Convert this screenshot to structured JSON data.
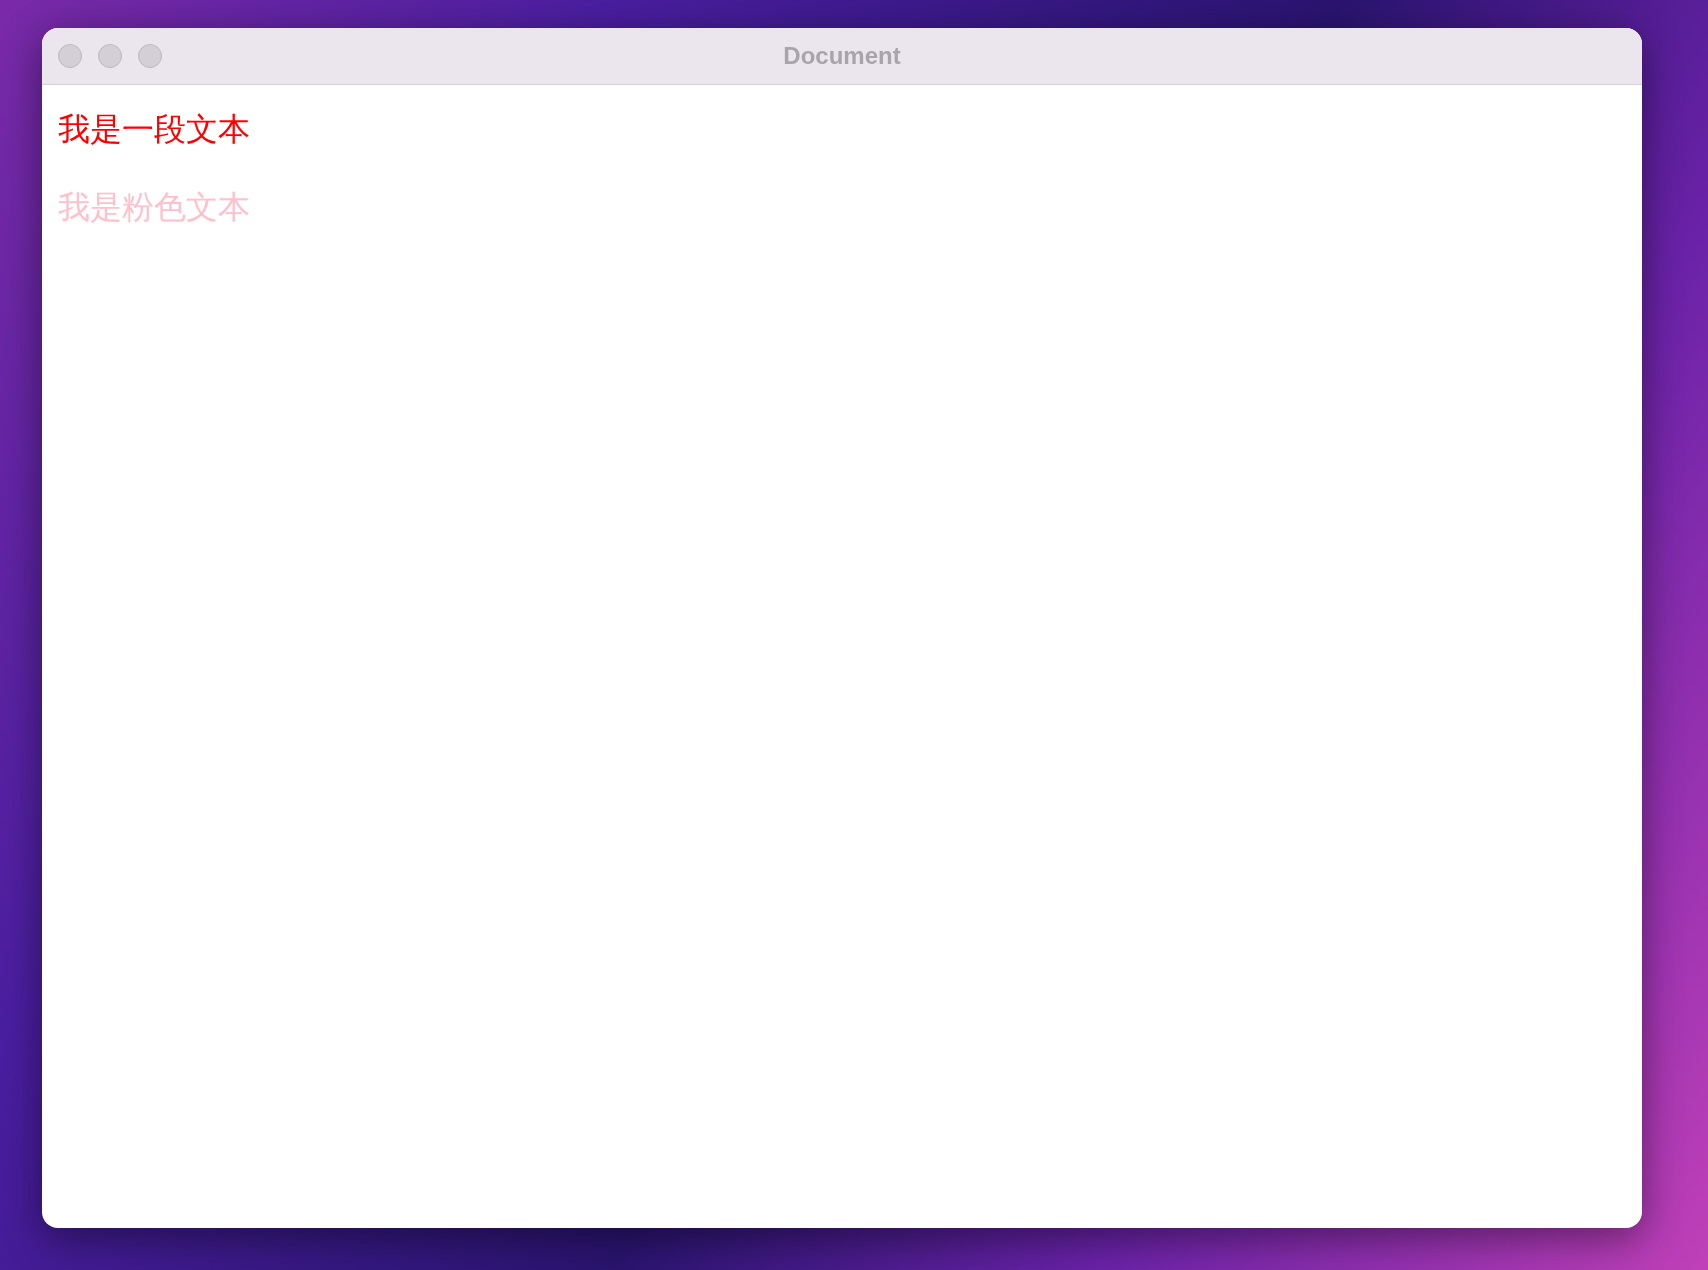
{
  "window": {
    "title": "Document",
    "focused": false
  },
  "paragraphs": [
    {
      "text": "我是一段文本",
      "color": "#ff0000"
    },
    {
      "text": "我是粉色文本",
      "color": "#ffc0cb"
    }
  ]
}
